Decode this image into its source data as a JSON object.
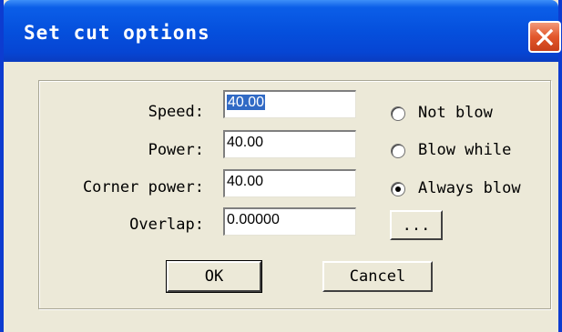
{
  "window": {
    "title": "Set cut options",
    "close_icon": "close-icon"
  },
  "fields": [
    {
      "label": "Speed:",
      "value": "40.00",
      "selected": true
    },
    {
      "label": "Power:",
      "value": "40.00"
    },
    {
      "label": "Corner power:",
      "value": "40.00"
    },
    {
      "label": "Overlap:",
      "value": "0.00000"
    }
  ],
  "radios": [
    {
      "label": "Not blow",
      "checked": false
    },
    {
      "label": "Blow while",
      "checked": false
    },
    {
      "label": "Always blow",
      "checked": true
    }
  ],
  "buttons": {
    "ellipsis": "...",
    "ok": "OK",
    "cancel": "Cancel"
  },
  "colors": {
    "titlebar": "#0550dd",
    "close": "#e2572b",
    "selection": "#316ac5",
    "face": "#ece9d8"
  }
}
